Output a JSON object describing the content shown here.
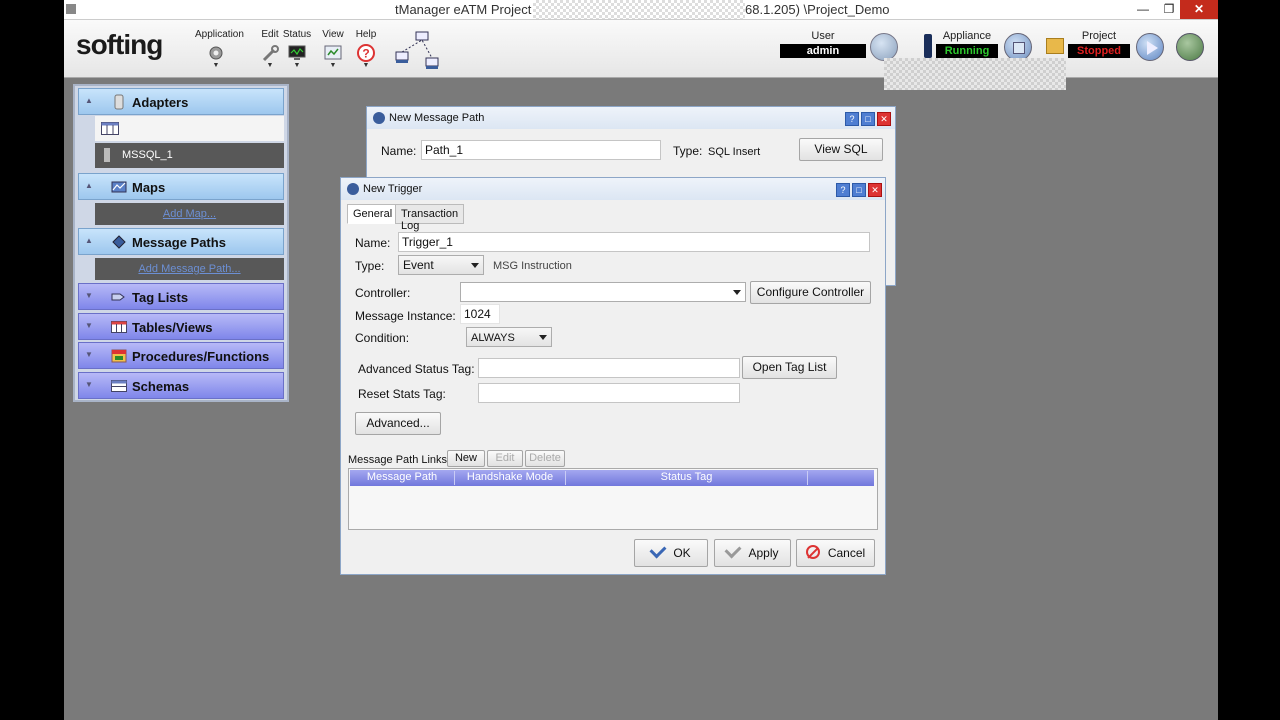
{
  "window": {
    "title_part1": "tManager eATM Project",
    "title_part2": "68.1.205) \\Project_Demo",
    "min_symbol": "—",
    "max_symbol": "❐",
    "close_symbol": "✕"
  },
  "toolbar": {
    "logo": "softing",
    "menus": [
      {
        "label": "Application",
        "icon": "gear-icon"
      },
      {
        "label": "Edit",
        "icon": "wrench-icon"
      },
      {
        "label": "Status",
        "icon": "monitor-icon"
      },
      {
        "label": "View",
        "icon": "view-icon"
      },
      {
        "label": "Help",
        "icon": "help-icon"
      }
    ],
    "user_label": "User",
    "user_value": "admin",
    "appliance_label": "Appliance",
    "appliance_value": "Running",
    "project_label": "Project",
    "project_value": "Stopped",
    "colors": {
      "running": "#2ec92e",
      "stopped": "#e02020"
    }
  },
  "sidebar": {
    "adapters": {
      "label": "Adapters",
      "items": [
        "MSSQL_1"
      ]
    },
    "maps": {
      "label": "Maps",
      "link": "Add Map..."
    },
    "message_paths": {
      "label": "Message Paths",
      "link": "Add Message Path..."
    },
    "tag_lists": {
      "label": "Tag Lists"
    },
    "tables_views": {
      "label": "Tables/Views"
    },
    "procedures": {
      "label": "Procedures/Functions"
    },
    "schemas": {
      "label": "Schemas"
    }
  },
  "msgpath_dialog": {
    "title": "New Message Path",
    "name_label": "Name:",
    "name_value": "Path_1",
    "type_label": "Type:",
    "type_value": "SQL Insert",
    "view_sql": "View SQL"
  },
  "trigger_dialog": {
    "title": "New Trigger",
    "tabs": [
      "General",
      "Transaction Log"
    ],
    "name_label": "Name:",
    "name_value": "Trigger_1",
    "type_label": "Type:",
    "type_value": "Event",
    "type_hint": "MSG Instruction",
    "controller_label": "Controller:",
    "controller_value": "",
    "configure_controller": "Configure Controller",
    "message_instance_label": "Message Instance:",
    "message_instance_value": "1024",
    "condition_label": "Condition:",
    "condition_value": "ALWAYS",
    "adv_status_tag_label": "Advanced Status Tag:",
    "open_tag_list": "Open Tag List",
    "reset_stats_tag_label": "Reset Stats Tag:",
    "advanced_button": "Advanced...",
    "links_label": "Message Path Links:",
    "links_new": "New",
    "links_edit": "Edit",
    "links_delete": "Delete",
    "columns": [
      "Message Path",
      "Handshake Mode",
      "Status Tag"
    ],
    "ok": "OK",
    "apply": "Apply",
    "cancel": "Cancel"
  }
}
